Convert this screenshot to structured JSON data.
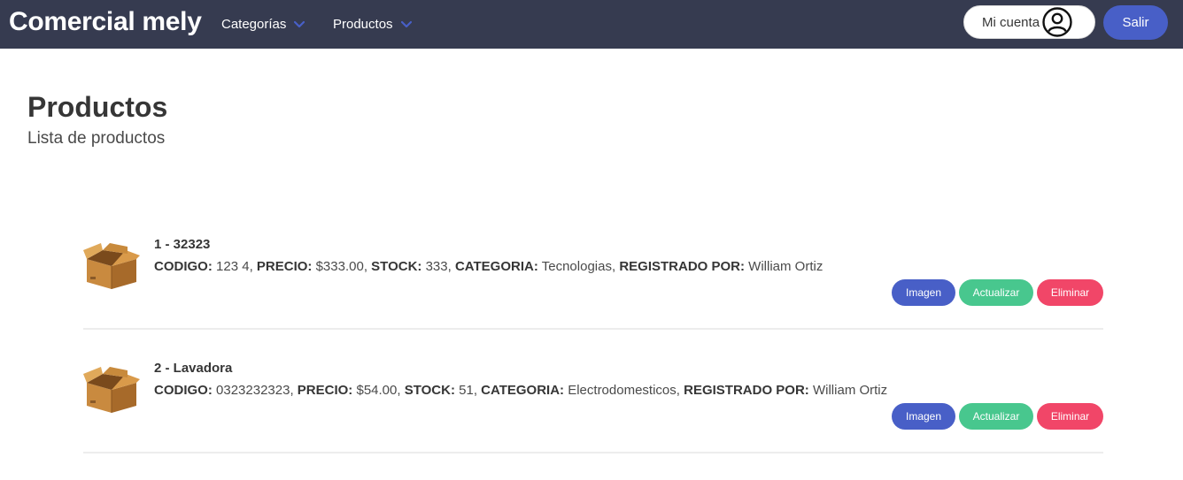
{
  "navbar": {
    "brand": "Comercial mely",
    "menu": [
      {
        "label": "Categorías",
        "icon": "chevron-down-icon"
      },
      {
        "label": "Productos",
        "icon": "chevron-down-icon"
      }
    ],
    "account_label": "Mi cuenta",
    "account_icon": "user-avatar-icon",
    "logout_label": "Salir",
    "colors": {
      "background": "#363b50",
      "primary": "#485fc7",
      "chevron": "#485fc7"
    }
  },
  "page": {
    "title": "Productos",
    "subtitle": "Lista de productos"
  },
  "labels": {
    "codigo": "CODIGO:",
    "precio": "PRECIO:",
    "stock": "STOCK:",
    "categoria": "CATEGORIA:",
    "registrado": "REGISTRADO POR:"
  },
  "products": [
    {
      "name": "1 - 32323",
      "codigo": "123 4",
      "precio": "$333.00",
      "stock": "333",
      "categoria": "Tecnologias",
      "registrado": "William Ortiz",
      "icon": "cardboard-box-icon",
      "actions": {
        "imagen": "Imagen",
        "actualizar": "Actualizar",
        "eliminar": "Eliminar"
      }
    },
    {
      "name": "2 - Lavadora",
      "codigo": "0323232323",
      "precio": "$54.00",
      "stock": "51",
      "categoria": "Electrodomesticos",
      "registrado": "William Ortiz",
      "icon": "cardboard-box-icon",
      "actions": {
        "imagen": "Imagen",
        "actualizar": "Actualizar",
        "eliminar": "Eliminar"
      }
    }
  ],
  "button_colors": {
    "imagen": "#485fc7",
    "actualizar": "#48c78e",
    "eliminar": "#f14668"
  }
}
